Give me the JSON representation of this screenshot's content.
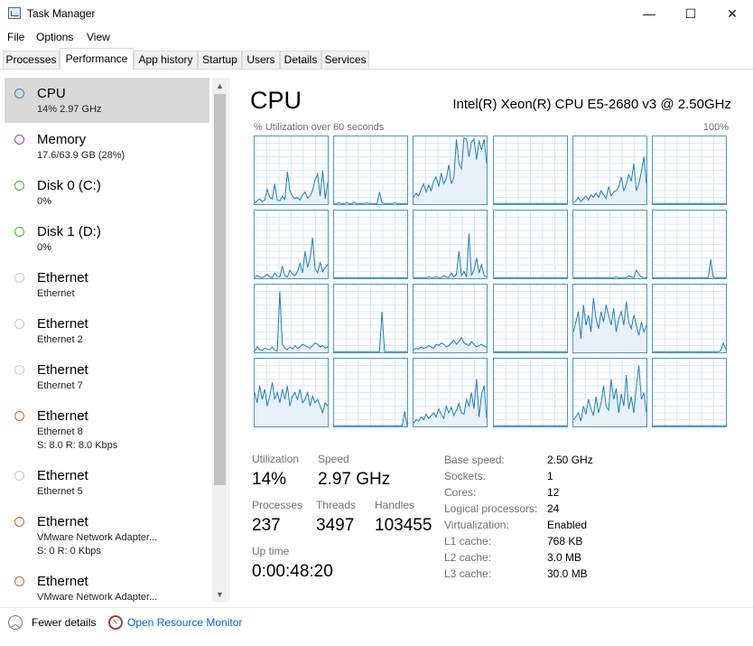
{
  "window": {
    "title": "Task Manager",
    "minimize": "—",
    "maximize": "☐",
    "close": "✕"
  },
  "menu": [
    "File",
    "Options",
    "View"
  ],
  "tabs": [
    "Processes",
    "Performance",
    "App history",
    "Startup",
    "Users",
    "Details",
    "Services"
  ],
  "active_tab": "Performance",
  "sidebar": {
    "items": [
      {
        "name": "CPU",
        "sub": "14%  2.97 GHz",
        "sub2": "",
        "color": "#1f8fd6",
        "selected": true
      },
      {
        "name": "Memory",
        "sub": "17.6/63.9 GB (28%)",
        "sub2": "",
        "color": "#a040c0"
      },
      {
        "name": "Disk 0 (C:)",
        "sub": "0%",
        "sub2": "",
        "color": "#4caa3c"
      },
      {
        "name": "Disk 1 (D:)",
        "sub": "0%",
        "sub2": "",
        "color": "#4caa3c"
      },
      {
        "name": "Ethernet",
        "sub": "Ethernet",
        "sub2": "",
        "color": "#c8c8c8"
      },
      {
        "name": "Ethernet",
        "sub": "Ethernet 2",
        "sub2": "",
        "color": "#c8c8c8"
      },
      {
        "name": "Ethernet",
        "sub": "Ethernet 7",
        "sub2": "",
        "color": "#c8c8c8"
      },
      {
        "name": "Ethernet",
        "sub": "Ethernet 8",
        "sub2": "S: 8.0  R: 8.0 Kbps",
        "color": "#c06a28"
      },
      {
        "name": "Ethernet",
        "sub": "Ethernet 5",
        "sub2": "",
        "color": "#c8c8c8"
      },
      {
        "name": "Ethernet",
        "sub": "VMware Network Adapter...",
        "sub2": "S: 0  R: 0 Kbps",
        "color": "#c06a28"
      },
      {
        "name": "Ethernet",
        "sub": "VMware Network Adapter...",
        "sub2": "",
        "color": "#c06a28"
      }
    ]
  },
  "main": {
    "title": "CPU",
    "model": "Intel(R) Xeon(R) CPU E5-2680 v3 @ 2.50GHz",
    "graph_caption": "% Utilization over 60 seconds",
    "graph_max": "100%",
    "graph_line_color": "#1f7fbf",
    "graph_fill_color": "#e8f1f9",
    "logical_cores": [
      [
        2,
        5,
        8,
        4,
        6,
        22,
        10,
        8,
        30,
        6,
        5,
        12,
        7,
        48,
        20,
        12,
        8,
        10,
        6,
        14,
        18,
        9,
        12,
        20,
        36,
        45,
        12,
        50,
        8,
        32
      ],
      [
        1,
        1,
        2,
        1,
        1,
        2,
        1,
        1,
        3,
        1,
        1,
        1,
        1,
        2,
        1,
        1,
        1,
        1,
        18,
        2,
        1,
        1,
        1,
        1,
        2,
        1,
        1,
        1,
        1,
        1
      ],
      [
        10,
        16,
        12,
        22,
        30,
        18,
        28,
        20,
        34,
        40,
        26,
        46,
        30,
        38,
        58,
        30,
        40,
        96,
        60,
        52,
        98,
        96,
        70,
        92,
        96,
        66,
        94,
        80,
        96,
        60
      ],
      [
        1,
        1,
        1,
        1,
        1,
        1,
        1,
        1,
        1,
        1,
        1,
        1,
        1,
        1,
        1,
        1,
        1,
        1,
        1,
        1,
        1,
        1,
        1,
        1,
        1,
        1,
        1,
        1,
        1,
        1
      ],
      [
        3,
        5,
        10,
        4,
        8,
        12,
        6,
        14,
        10,
        16,
        10,
        20,
        14,
        8,
        26,
        12,
        18,
        20,
        26,
        40,
        20,
        30,
        44,
        34,
        60,
        20,
        30,
        48,
        70,
        30
      ],
      [
        1,
        1,
        1,
        1,
        1,
        1,
        1,
        1,
        1,
        1,
        1,
        1,
        1,
        1,
        1,
        1,
        1,
        1,
        1,
        1,
        1,
        1,
        1,
        1,
        1,
        1,
        1,
        1,
        1,
        1
      ],
      [
        1,
        4,
        2,
        1,
        3,
        6,
        2,
        1,
        8,
        3,
        2,
        18,
        4,
        2,
        12,
        6,
        4,
        10,
        22,
        8,
        40,
        16,
        30,
        60,
        14,
        8,
        24,
        10,
        16,
        20
      ],
      [
        1,
        1,
        1,
        1,
        1,
        1,
        1,
        1,
        1,
        1,
        1,
        1,
        1,
        1,
        1,
        1,
        1,
        1,
        1,
        1,
        1,
        1,
        1,
        1,
        1,
        1,
        1,
        1,
        1,
        1
      ],
      [
        1,
        1,
        1,
        1,
        1,
        1,
        2,
        1,
        1,
        2,
        1,
        1,
        4,
        2,
        1,
        8,
        2,
        6,
        40,
        4,
        10,
        2,
        66,
        4,
        12,
        30,
        8,
        20,
        4,
        2
      ],
      [
        1,
        1,
        1,
        1,
        1,
        1,
        1,
        1,
        1,
        1,
        1,
        1,
        1,
        1,
        1,
        1,
        1,
        1,
        1,
        1,
        1,
        1,
        1,
        1,
        1,
        1,
        1,
        1,
        1,
        1
      ],
      [
        1,
        1,
        1,
        1,
        1,
        1,
        1,
        1,
        1,
        1,
        1,
        1,
        1,
        1,
        1,
        1,
        1,
        2,
        1,
        1,
        1,
        1,
        4,
        2,
        1,
        12,
        6,
        2,
        1,
        1
      ],
      [
        1,
        1,
        1,
        1,
        1,
        1,
        1,
        1,
        1,
        1,
        1,
        1,
        1,
        1,
        1,
        1,
        1,
        1,
        1,
        1,
        1,
        1,
        1,
        28,
        1,
        1,
        1,
        1,
        1,
        1
      ],
      [
        2,
        8,
        4,
        3,
        6,
        5,
        4,
        8,
        3,
        2,
        90,
        12,
        6,
        4,
        8,
        5,
        10,
        6,
        8,
        12,
        10,
        8,
        6,
        10,
        14,
        12,
        8,
        10,
        6,
        8
      ],
      [
        1,
        1,
        1,
        1,
        1,
        1,
        1,
        1,
        1,
        1,
        1,
        1,
        1,
        1,
        1,
        1,
        1,
        1,
        1,
        60,
        1,
        1,
        1,
        1,
        1,
        1,
        1,
        1,
        1,
        1
      ],
      [
        4,
        6,
        5,
        8,
        6,
        7,
        10,
        8,
        6,
        12,
        10,
        14,
        12,
        8,
        10,
        14,
        18,
        12,
        16,
        22,
        14,
        12,
        10,
        16,
        12,
        8,
        10,
        12,
        9,
        8
      ],
      [
        1,
        1,
        1,
        1,
        1,
        1,
        1,
        1,
        1,
        1,
        1,
        1,
        1,
        1,
        1,
        1,
        1,
        1,
        1,
        1,
        1,
        1,
        1,
        1,
        1,
        1,
        1,
        1,
        1,
        1
      ],
      [
        30,
        45,
        60,
        20,
        70,
        40,
        55,
        30,
        80,
        50,
        35,
        60,
        45,
        70,
        55,
        40,
        65,
        30,
        50,
        60,
        40,
        75,
        45,
        35,
        55,
        40,
        25,
        45,
        30,
        40
      ],
      [
        1,
        1,
        1,
        1,
        1,
        1,
        1,
        1,
        1,
        1,
        1,
        1,
        1,
        1,
        1,
        1,
        1,
        1,
        1,
        1,
        1,
        1,
        1,
        1,
        1,
        1,
        1,
        3,
        14,
        4
      ],
      [
        50,
        35,
        60,
        40,
        55,
        30,
        45,
        65,
        40,
        50,
        35,
        55,
        40,
        60,
        30,
        45,
        50,
        40,
        55,
        35,
        40,
        50,
        30,
        45,
        35,
        40,
        30,
        20,
        35,
        30
      ],
      [
        1,
        1,
        1,
        1,
        1,
        1,
        1,
        1,
        1,
        1,
        1,
        1,
        1,
        1,
        1,
        1,
        1,
        1,
        1,
        1,
        1,
        1,
        1,
        1,
        1,
        1,
        1,
        1,
        22,
        1
      ],
      [
        5,
        10,
        8,
        14,
        10,
        18,
        12,
        16,
        20,
        14,
        26,
        18,
        12,
        30,
        20,
        28,
        16,
        24,
        34,
        20,
        18,
        40,
        30,
        50,
        26,
        70,
        14,
        48,
        60,
        12
      ],
      [
        1,
        1,
        1,
        1,
        1,
        1,
        1,
        1,
        1,
        1,
        1,
        1,
        1,
        1,
        1,
        1,
        1,
        1,
        1,
        1,
        1,
        1,
        1,
        1,
        1,
        1,
        1,
        1,
        1,
        1
      ],
      [
        10,
        14,
        20,
        8,
        30,
        18,
        40,
        26,
        16,
        44,
        20,
        34,
        60,
        30,
        24,
        70,
        40,
        56,
        20,
        48,
        30,
        76,
        26,
        44,
        20,
        60,
        90,
        40,
        50,
        20
      ],
      [
        1,
        1,
        1,
        1,
        1,
        1,
        1,
        1,
        1,
        1,
        1,
        1,
        1,
        1,
        1,
        1,
        1,
        1,
        1,
        1,
        1,
        1,
        1,
        1,
        1,
        1,
        1,
        1,
        1,
        1
      ]
    ],
    "stats": {
      "utilization_label": "Utilization",
      "utilization_value": "14%",
      "speed_label": "Speed",
      "speed_value": "2.97 GHz",
      "processes_label": "Processes",
      "processes_value": "237",
      "threads_label": "Threads",
      "threads_value": "3497",
      "handles_label": "Handles",
      "handles_value": "103455",
      "uptime_label": "Up time",
      "uptime_value": "0:00:48:20"
    },
    "details": [
      {
        "label": "Base speed:",
        "value": "2.50 GHz"
      },
      {
        "label": "Sockets:",
        "value": "1"
      },
      {
        "label": "Cores:",
        "value": "12"
      },
      {
        "label": "Logical processors:",
        "value": "24"
      },
      {
        "label": "Virtualization:",
        "value": "Enabled"
      },
      {
        "label": "L1 cache:",
        "value": "768 KB"
      },
      {
        "label": "L2 cache:",
        "value": "3.0 MB"
      },
      {
        "label": "L3 cache:",
        "value": "30.0 MB"
      }
    ]
  },
  "footer": {
    "fewer_details": "Fewer details",
    "open_resmon": "Open Resource Monitor"
  }
}
